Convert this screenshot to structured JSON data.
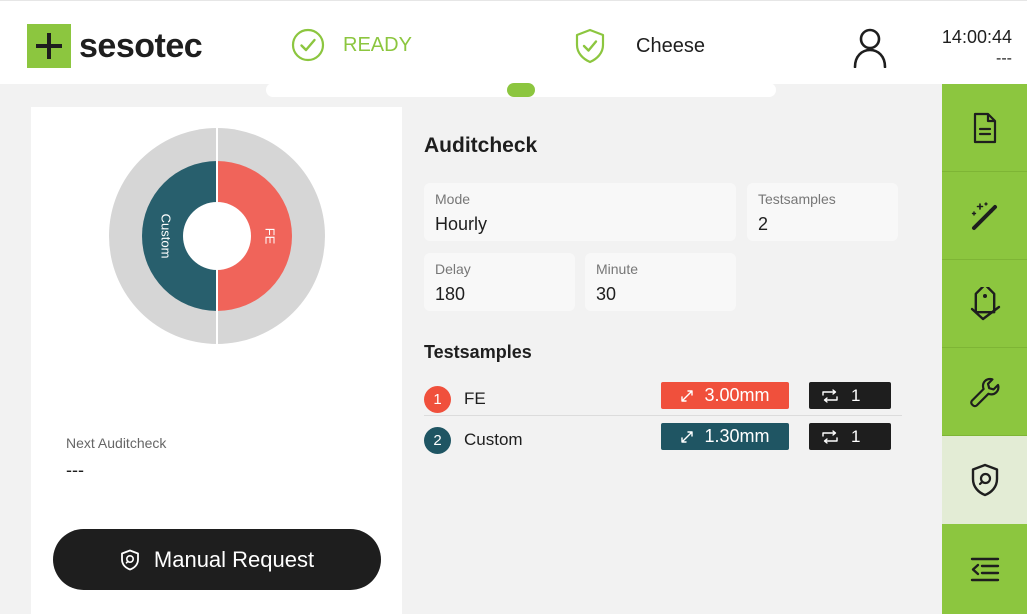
{
  "header": {
    "brand": "sesotec",
    "status": "READY",
    "product": "Cheese",
    "time": "14:00:44",
    "date": "---"
  },
  "progress": {
    "position": 0.5
  },
  "donut": {
    "segments": [
      {
        "label": "Custom",
        "color": "#285f6d"
      },
      {
        "label": "FE",
        "color": "#f0645a"
      }
    ],
    "ring_color": "#d6d6d6"
  },
  "next_auditcheck": {
    "label": "Next Auditcheck",
    "value": "---"
  },
  "manual_request": {
    "label": "Manual Request"
  },
  "auditcheck": {
    "title": "Auditcheck",
    "mode": {
      "label": "Mode",
      "value": "Hourly"
    },
    "testsamples": {
      "label": "Testsamples",
      "value": "2"
    },
    "delay": {
      "label": "Delay",
      "value": "180"
    },
    "minute": {
      "label": "Minute",
      "value": "30"
    }
  },
  "testsamples": {
    "title": "Testsamples",
    "items": [
      {
        "num": "1",
        "name": "FE",
        "size": "3.00mm",
        "count": "1",
        "color": "#f0503c"
      },
      {
        "num": "2",
        "name": "Custom",
        "size": "1.30mm",
        "count": "1",
        "color": "#1f5563"
      }
    ]
  },
  "sidebar": {
    "items": [
      {
        "icon": "document-icon"
      },
      {
        "icon": "magic-wand-icon"
      },
      {
        "icon": "tags-icon"
      },
      {
        "icon": "wrench-icon"
      },
      {
        "icon": "auditcheck-shield-icon",
        "active": true
      },
      {
        "icon": "menu-collapse-icon"
      }
    ]
  },
  "colors": {
    "accent": "#8cc63f",
    "dark": "#1e1e1e",
    "background": "#f2f2f2"
  }
}
